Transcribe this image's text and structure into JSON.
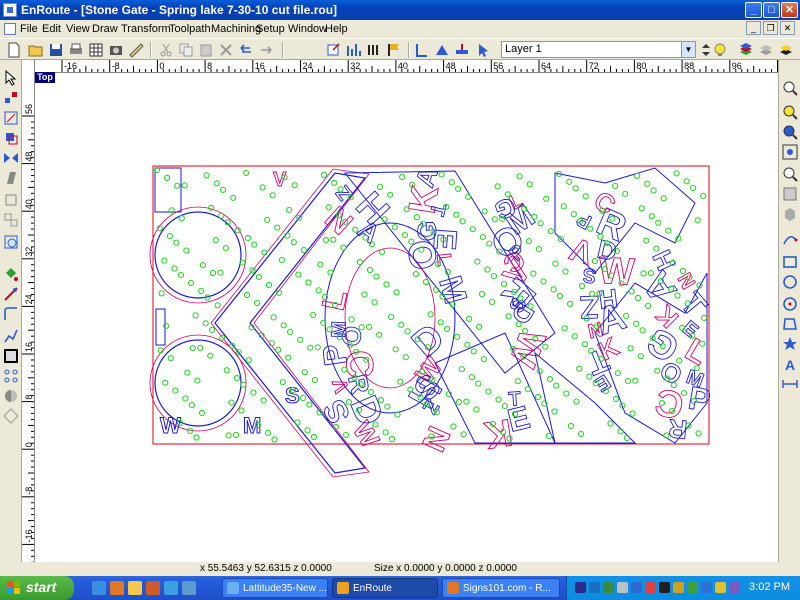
{
  "window": {
    "title": "EnRoute - [Stone Gate - Spring lake 7-30-10 cut file.rou]"
  },
  "menu": [
    "File",
    "Edit",
    "View",
    "Draw",
    "Transform",
    "Toolpath",
    "Machining",
    "Setup",
    "Window",
    "Help"
  ],
  "toolbar": {
    "layer_value": "Layer 1",
    "icons": [
      "new-icon",
      "open-icon",
      "save-icon",
      "print-icon",
      "grid-icon",
      "camera-icon",
      "ruler-icon",
      "cut-icon",
      "copy-icon",
      "paste-icon",
      "delete-icon",
      "undo-icon",
      "redo-icon",
      "layer-icon"
    ]
  },
  "view": {
    "label": "Top"
  },
  "rulers": {
    "horizontal": [
      "-16",
      "-8",
      "0",
      "8",
      "16",
      "24",
      "32",
      "40",
      "48",
      "56",
      "64",
      "72",
      "80",
      "88",
      "96",
      "104"
    ],
    "vertical": [
      "56",
      "48",
      "40",
      "32",
      "24",
      "16",
      "8",
      "0",
      "-8",
      "-16"
    ]
  },
  "canvas": {
    "letters": [
      "V",
      "A",
      "M",
      "W",
      "E",
      "R",
      "N",
      "O",
      "S",
      "K",
      "P",
      "H",
      "L",
      "D",
      "T",
      "C",
      "Z",
      "G"
    ],
    "colors": {
      "border": "#e0001a",
      "vector": "#1a1ad0",
      "offset": "#d0006a",
      "node": "#22d422"
    }
  },
  "status": {
    "coords": "x 55.5463 y 52.6315 z 0.0000",
    "size": "Size x 0.0000 y 0.0000 z 0.0000"
  },
  "taskbar": {
    "start": "start",
    "tasks": [
      "Lattitude35-New ...",
      "EnRoute",
      "Signs101.com - R..."
    ],
    "clock": "3:02 PM"
  }
}
